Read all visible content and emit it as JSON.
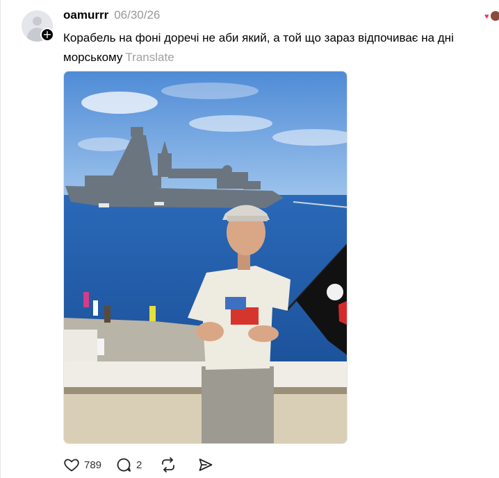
{
  "post": {
    "username": "oamurrr",
    "timestamp": "06/30/26",
    "text": "Корабель на фоні доречі не аби який, а той що зараз відпочиває на дні морському",
    "translate_label": "Translate",
    "image_alt": "Boy in a cap holding a black flag on a seaside embankment with a grey warship in the background"
  },
  "actions": {
    "like_count": "789",
    "reply_count": "2"
  },
  "icons": {
    "avatar": "default-avatar-icon",
    "follow": "plus-icon",
    "like": "heart-icon",
    "reply": "comment-icon",
    "repost": "repost-icon",
    "share": "send-icon"
  },
  "colors": {
    "sky": "#6a9fde",
    "sea": "#1c5aa6",
    "text_muted": "#999999"
  }
}
